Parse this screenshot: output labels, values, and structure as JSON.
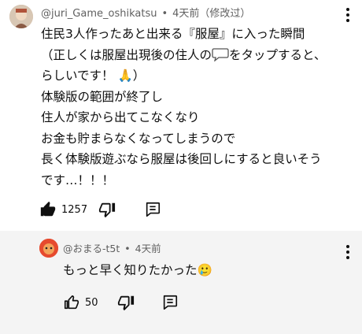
{
  "comments": [
    {
      "author": "@juri_Game_oshikatsu",
      "time": "4天前（修改过）",
      "lines": [
        "住民3人作ったあと出来る『服屋』に入った瞬間",
        "（正しくは服屋出現後の住人の",
        "らしいです！ 🙏）",
        "体験版の範囲が終了し",
        "住人が家から出てこなくなり",
        "お金も貯まらなくなってしまうので",
        "長く体験版遊ぶなら服屋は後回しにすると良いそう",
        "です…！！！"
      ],
      "line2_suffix": "をタップすると、",
      "likes": "1257"
    },
    {
      "author": "@おまる-t5t",
      "time": "4天前",
      "text": "もっと早く知りたかった🥲",
      "likes": "50"
    }
  ],
  "separator": "•",
  "colors": {
    "meta": "#606060",
    "reply_bg": "#f4f4f4",
    "text": "#0f0f0f"
  },
  "icons": [
    "avatar-juri",
    "avatar-omaru",
    "more-vert-icon",
    "thumb-up-filled-icon",
    "thumb-up-outline-icon",
    "thumb-down-icon",
    "reply-icon",
    "speech-bubble-icon"
  ]
}
